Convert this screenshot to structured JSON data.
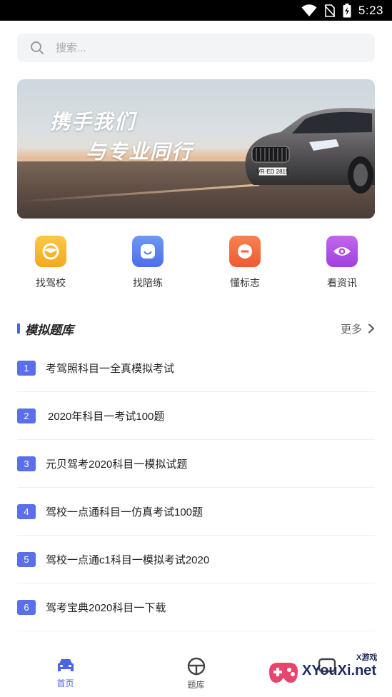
{
  "status": {
    "time": "5:23"
  },
  "search": {
    "placeholder": "搜索..."
  },
  "banner": {
    "line1": "携手我们",
    "line2": "与专业同行",
    "plate": "VR·ED 2815"
  },
  "quick": [
    {
      "label": "找驾校",
      "icon": "steering-wheel-icon",
      "color": "#f6b52f"
    },
    {
      "label": "找陪练",
      "icon": "smile-face-icon",
      "color": "#5b84ee"
    },
    {
      "label": "懂标志",
      "icon": "no-entry-icon",
      "color": "#f36a3e"
    },
    {
      "label": "看资讯",
      "icon": "eye-icon",
      "color": "#b24fe0"
    }
  ],
  "section": {
    "title": "模拟题库",
    "more": "更多"
  },
  "questions": [
    {
      "num": "1",
      "title": "考驾照科目一全真模拟考试"
    },
    {
      "num": "2",
      "title": "2020年科目一考试100题"
    },
    {
      "num": "3",
      "title": "元贝驾考2020科目一模拟试题"
    },
    {
      "num": "4",
      "title": "驾校一点通科目一仿真考试100题"
    },
    {
      "num": "5",
      "title": "驾校一点通c1科目一模拟考试2020"
    },
    {
      "num": "6",
      "title": "驾考宝典2020科目一下载"
    }
  ],
  "tabs": [
    {
      "label": "首页",
      "active": true
    },
    {
      "label": "题库",
      "active": false
    },
    {
      "label": "",
      "active": false
    }
  ],
  "watermark": {
    "text": "XYouXi.net",
    "small": "X游戏"
  },
  "colors": {
    "accent": "#4a64e8",
    "badge": "#5a6fe9"
  }
}
